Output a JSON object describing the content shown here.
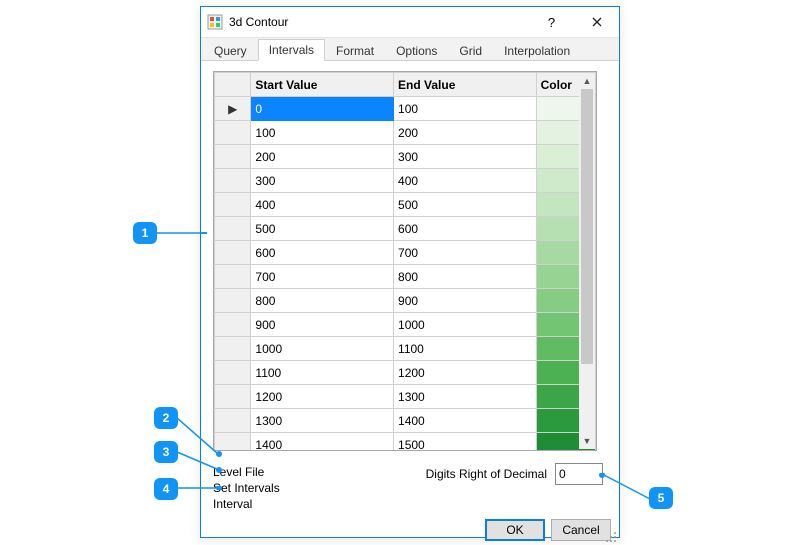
{
  "title": "3d Contour",
  "tabs": [
    "Query",
    "Intervals",
    "Format",
    "Options",
    "Grid",
    "Interpolation"
  ],
  "active_tab": 1,
  "grid": {
    "headers": [
      "Start Value",
      "End Value",
      "Color"
    ],
    "rows": [
      {
        "start": "0",
        "end": "100",
        "color": "#edf7ec"
      },
      {
        "start": "100",
        "end": "200",
        "color": "#e4f3e1"
      },
      {
        "start": "200",
        "end": "300",
        "color": "#daefd6"
      },
      {
        "start": "300",
        "end": "400",
        "color": "#cfeacb"
      },
      {
        "start": "400",
        "end": "500",
        "color": "#c3e5bf"
      },
      {
        "start": "500",
        "end": "600",
        "color": "#b6e0b1"
      },
      {
        "start": "600",
        "end": "700",
        "color": "#a7daa2"
      },
      {
        "start": "700",
        "end": "800",
        "color": "#97d393"
      },
      {
        "start": "800",
        "end": "900",
        "color": "#86cc83"
      },
      {
        "start": "900",
        "end": "1000",
        "color": "#73c473"
      },
      {
        "start": "1000",
        "end": "1100",
        "color": "#60bb62"
      },
      {
        "start": "1100",
        "end": "1200",
        "color": "#4cb152"
      },
      {
        "start": "1200",
        "end": "1300",
        "color": "#3aa648"
      },
      {
        "start": "1300",
        "end": "1400",
        "color": "#2b9a3e"
      },
      {
        "start": "1400",
        "end": "1500",
        "color": "#1e8d35"
      }
    ],
    "selected_row": 0
  },
  "links": {
    "level_file": "Level File",
    "set_intervals": "Set Intervals",
    "interval": "Interval"
  },
  "decimal": {
    "label": "Digits Right of Decimal",
    "value": "0"
  },
  "buttons": {
    "ok": "OK",
    "cancel": "Cancel"
  },
  "callouts": [
    "1",
    "2",
    "3",
    "4",
    "5"
  ]
}
